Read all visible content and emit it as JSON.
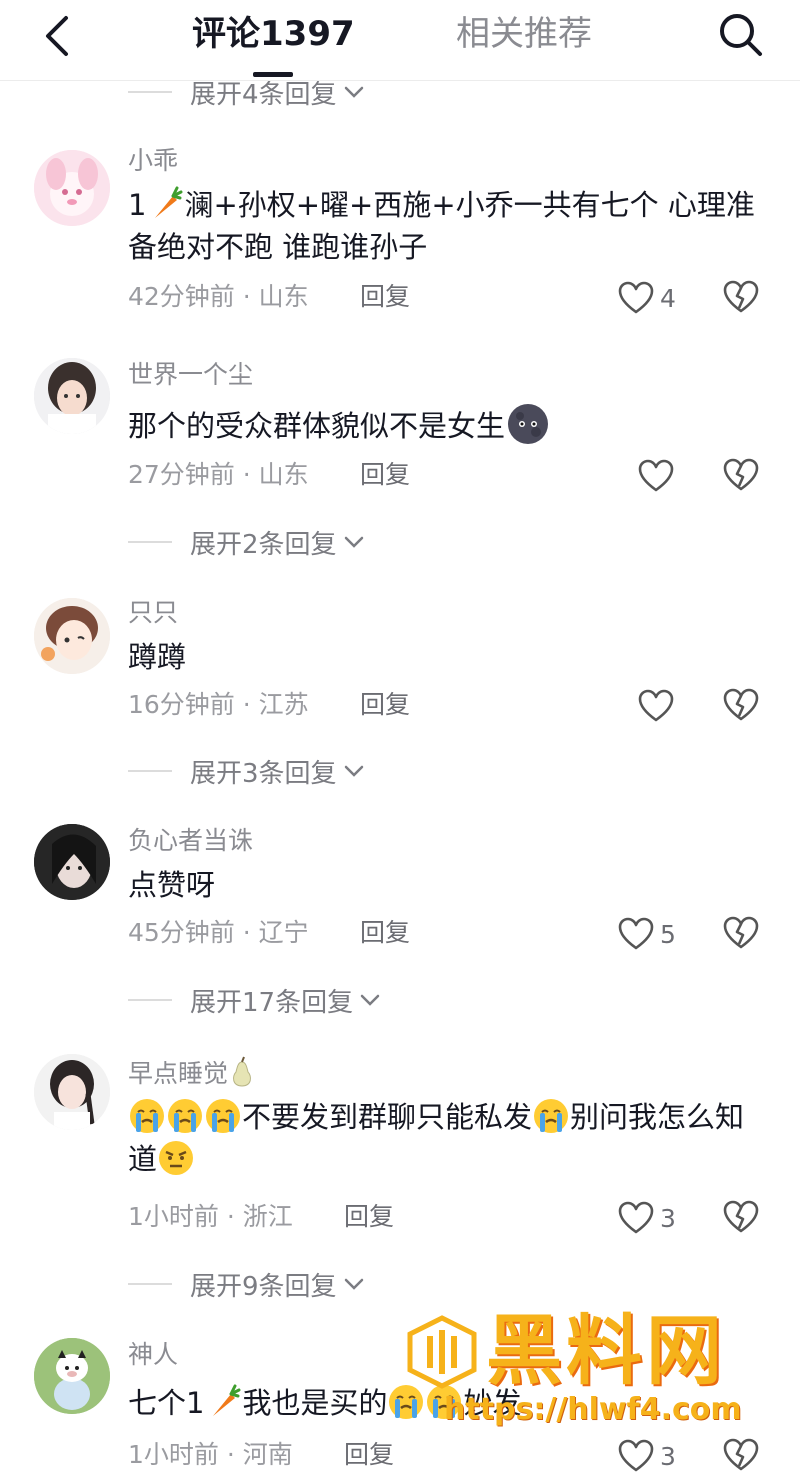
{
  "header": {
    "tab_comments": "评论1397",
    "tab_recommend": "相关推荐"
  },
  "top_expand": "展开4条回复",
  "comments": [
    {
      "username": "小乖",
      "text_a": "1",
      "text_b": "澜+孙权+曜+西施+小乔一共有七个 心理准备绝对不跑 谁跑谁孙子",
      "time": "42分钟前",
      "region": "山东",
      "reply": "回复",
      "likes": "4",
      "expand": ""
    },
    {
      "username": "世界一个尘",
      "text_a": "那个的受众群体貌似不是女生",
      "time": "27分钟前",
      "region": "山东",
      "reply": "回复",
      "likes": "",
      "expand": "展开2条回复"
    },
    {
      "username": "只只",
      "text_a": "蹲蹲",
      "time": "16分钟前",
      "region": "江苏",
      "reply": "回复",
      "likes": "",
      "expand": "展开3条回复"
    },
    {
      "username": "负心者当诛",
      "text_a": "点赞呀",
      "time": "45分钟前",
      "region": "辽宁",
      "reply": "回复",
      "likes": "5",
      "expand": "展开17条回复"
    },
    {
      "username": "早点睡觉",
      "text_a": "不要发到群聊只能私发",
      "text_b": "别问我怎么知道",
      "time": "1小时前",
      "region": "浙江",
      "reply": "回复",
      "likes": "3",
      "expand": "展开9条回复"
    },
    {
      "username": "神人",
      "text_a": "七个1",
      "text_b": "我也是买的",
      "text_c": "妙发",
      "time": "1小时前",
      "region": "河南",
      "reply": "回复",
      "likes": "3",
      "expand": ""
    }
  ],
  "meta_sep": "·",
  "watermark": {
    "title": "黑料网",
    "url": "https://hlwf4.com"
  },
  "icons": [
    "back-arrow-icon",
    "search-icon",
    "heart-icon",
    "broken-heart-icon",
    "chevron-down-icon",
    "carrot-emoji",
    "crying-emoji",
    "angry-emoji",
    "moon-emoji",
    "pear-emoji"
  ],
  "colors": {
    "primary_text": "#161823",
    "secondary_text": "#8a8b91",
    "watermark": "#f6b21a"
  }
}
